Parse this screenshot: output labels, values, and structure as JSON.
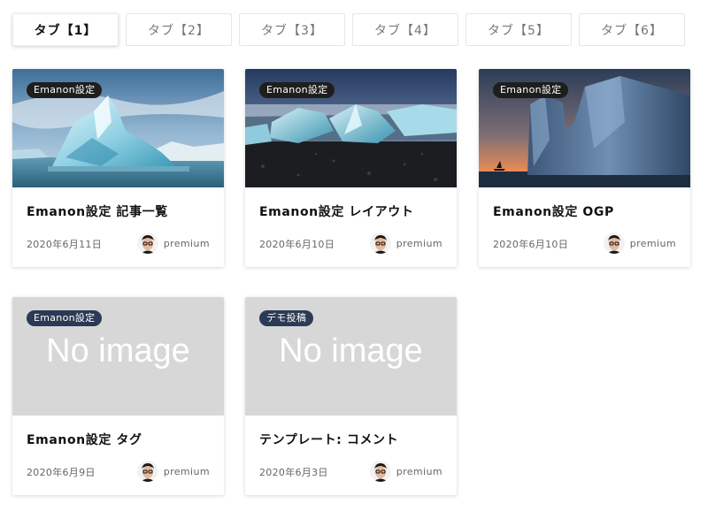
{
  "tabs": [
    {
      "label": "タブ【1】",
      "active": true
    },
    {
      "label": "タブ【2】",
      "active": false
    },
    {
      "label": "タブ【3】",
      "active": false
    },
    {
      "label": "タブ【4】",
      "active": false
    },
    {
      "label": "タブ【5】",
      "active": false
    },
    {
      "label": "タブ【6】",
      "active": false
    }
  ],
  "cards": [
    {
      "category": "Emanon設定",
      "title": "Emanon設定 記事一覧",
      "date": "2020年6月11日",
      "author": "premium",
      "thumb": "iceberg-glacier"
    },
    {
      "category": "Emanon設定",
      "title": "Emanon設定 レイアウト",
      "date": "2020年6月10日",
      "author": "premium",
      "thumb": "ice-beach"
    },
    {
      "category": "Emanon設定",
      "title": "Emanon設定 OGP",
      "date": "2020年6月10日",
      "author": "premium",
      "thumb": "iceberg-sunset"
    },
    {
      "category": "Emanon設定",
      "title": "Emanon設定 タグ",
      "date": "2020年6月9日",
      "author": "premium",
      "thumb": "no-image",
      "placeholder": "No image"
    },
    {
      "category": "デモ投稿",
      "title": "テンプレート: コメント",
      "date": "2020年6月3日",
      "author": "premium",
      "thumb": "no-image",
      "placeholder": "No image"
    }
  ],
  "colors": {
    "badge_dark": "#1e1e1e",
    "badge_navy": "#2b3a55",
    "noimage_bg": "#d7d7d7"
  }
}
